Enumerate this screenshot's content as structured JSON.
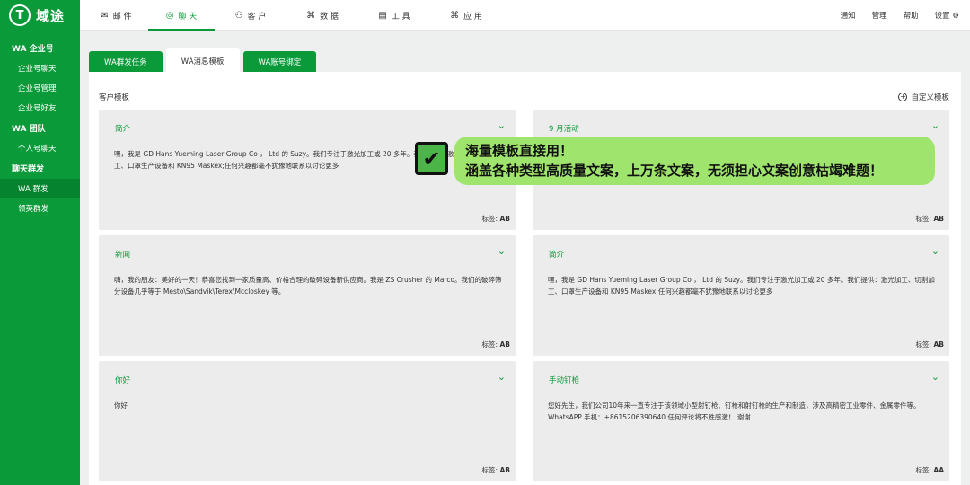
{
  "app": {
    "logo_mark": "T",
    "logo_text": "域途"
  },
  "sidebar": {
    "groups": [
      {
        "title": "WA 企业号",
        "items": [
          "企业号聊天",
          "企业号管理",
          "企业号好友"
        ]
      },
      {
        "title": "WA 团队",
        "items": [
          "个人号聊天"
        ]
      },
      {
        "title": "聊天群发",
        "items": [
          "WA 群发",
          "领英群发"
        ]
      }
    ],
    "active_item": "WA 群发"
  },
  "topnav": {
    "items": [
      {
        "label": "邮 件",
        "icon": "mail-icon"
      },
      {
        "label": "聊 天",
        "icon": "chat-icon"
      },
      {
        "label": "客 户",
        "icon": "users-icon"
      },
      {
        "label": "数 据",
        "icon": "data-icon"
      },
      {
        "label": "工 具",
        "icon": "toolbox-icon"
      },
      {
        "label": "应 用",
        "icon": "apps-icon"
      }
    ],
    "active": "聊 天",
    "right": [
      "通知",
      "管理",
      "帮助",
      "设置 ⚙"
    ]
  },
  "tabs": [
    "WA群发任务",
    "WA消息模板",
    "WA账号绑定"
  ],
  "active_tab": "WA消息模板",
  "panel": {
    "title": "客户模板",
    "custom_label": "自定义模板"
  },
  "cards": [
    {
      "title": "简介",
      "body": "嘿，我是 GD Hans Yueming Laser Group Co ， Ltd 的 Suzy。我们专注于激光加工或 20 多年。我们提供：激光加工、切割加工、口罩生产设备和 KN95 Maskex;任何兴趣都毫不犹豫地联系以讨论更多",
      "tag_label": "标签:",
      "tag": "AB"
    },
    {
      "title": "9 月活动",
      "body": "",
      "tag_label": "标签:",
      "tag": "AB"
    },
    {
      "title": "新闻",
      "body": "嗨，我的朋友：美好的一天！恭喜您找到一家质量高、价格合理的破碎设备新供应商。我是 ZS Crusher 的 Marco。我们的破碎筛分设备几乎等于 Mesto\\Sandvik\\Terex\\Mccloskey 等。",
      "tag_label": "标签:",
      "tag": "AB"
    },
    {
      "title": "简介",
      "body": "嘿，我是 GD Hans Yueming Laser Group Co ， Ltd 的 Suzy。我们专注于激光加工或 20 多年。我们提供：激光加工、切割加工、口罩生产设备和 KN95 Maskex;任何兴趣都毫不犹豫地联系以讨论更多",
      "tag_label": "标签:",
      "tag": "AB"
    },
    {
      "title": "你好",
      "body": "你好",
      "tag_label": "标签:",
      "tag": "AB"
    },
    {
      "title": "手动钉枪",
      "body": "您好先生，我们公司10年来一直专注于该领域小型射钉枪、钉枪和射钉枪的生产和制造，涉及高精密工业零件、金属零件等。WhatsAPP 手机：+8615206390640 任何评论将不胜感激！ 谢谢",
      "tag_label": "标签:",
      "tag": "AA"
    }
  ],
  "banner": {
    "line1": "海量模板直接用！",
    "line2": "涵盖各种类型高质量文案，上万条文案，无须担心文案创意枯竭难题！"
  }
}
